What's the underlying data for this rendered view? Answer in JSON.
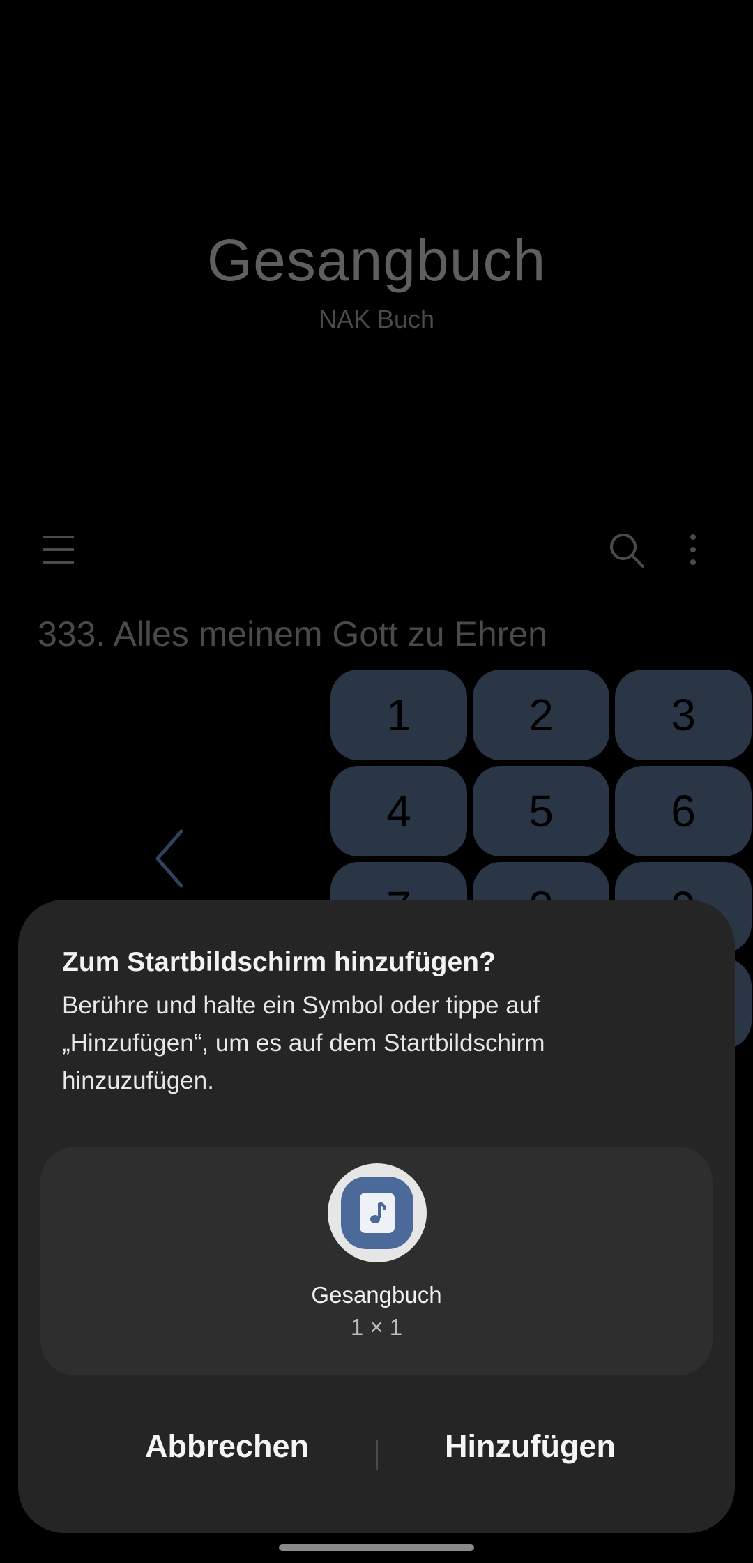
{
  "app": {
    "title": "Gesangbuch",
    "subtitle": "NAK Buch",
    "song_title": "333. Alles meinem Gott zu Ehren",
    "keypad": [
      "1",
      "2",
      "3",
      "4",
      "5",
      "6",
      "7",
      "8",
      "9"
    ],
    "icons": {
      "menu": "menu-icon",
      "search": "search-icon",
      "more": "more-vert-icon",
      "back": "chevron-left-icon"
    }
  },
  "dialog": {
    "title": "Zum Startbildschirm hinzufügen?",
    "body": "Berühre und halte ein Symbol oder tippe auf „Hinzufügen“, um es auf dem Startbildschirm hinzuzufügen.",
    "widget": {
      "name": "Gesangbuch",
      "size": "1 × 1",
      "icon": "music-note-icon"
    },
    "cancel_label": "Abbrechen",
    "add_label": "Hinzufügen"
  },
  "colors": {
    "background": "#000000",
    "dialog": "#252525",
    "key": "#2a3546",
    "accent": "#4b6a99"
  }
}
